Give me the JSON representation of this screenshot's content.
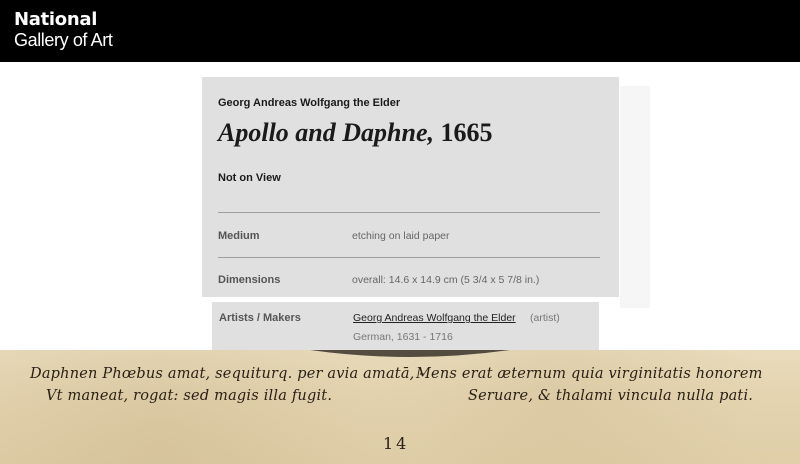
{
  "header": {
    "logo_line1": "National",
    "logo_line2": "Gallery of Art"
  },
  "artwork_info": {
    "artist": "Georg Andreas Wolfgang the Elder",
    "title": "Apollo and Daphne,",
    "year": "1665",
    "view_status": "Not on View",
    "details": {
      "medium_label": "Medium",
      "medium_value": "etching on laid paper",
      "dimensions_label": "Dimensions",
      "dimensions_value": "overall: 14.6 x 14.9 cm (5 3/4 x 5 7/8 in.)"
    },
    "makers": {
      "label": "Artists / Makers",
      "artist_link": "Georg Andreas Wolfgang the Elder",
      "role": "(artist)",
      "nationality_dates": "German, 1631 - 1716"
    }
  },
  "print_image": {
    "verse_line1": "Daphnen Phœbus amat, sequiturq. per avia amatā, -",
    "verse_line2": "Vt maneat, rogat: sed magis illa fugit.",
    "verse_line3": "Mens erat æternum quia virginitatis honorem",
    "verse_line4": "Seruare, & thalami vincula nulla pati.",
    "plate_number": "14",
    "paper_color": "#e4d4b0",
    "ink_color": "#2a2117"
  },
  "colors": {
    "header_bg": "#000000",
    "panel_bg": "#e0e0e0"
  }
}
